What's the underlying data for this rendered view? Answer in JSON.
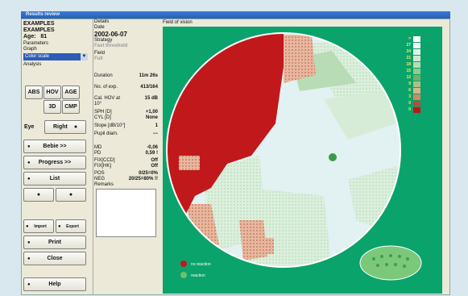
{
  "window": {
    "title": "Results review"
  },
  "patient": {
    "name1": "EXAMPLES",
    "name2": "EXAMPLES",
    "age_label": "Age:",
    "age": "81"
  },
  "parameters": {
    "label": "Parameters",
    "graph_label": "Graph",
    "graph_value": "Color scale"
  },
  "analysis": {
    "label": "Analysis",
    "abs": "ABS",
    "hov": "HOV",
    "age": "AGE",
    "threed": "3D",
    "cmp": "CMP",
    "eye_label": "Eye",
    "eye_value": "Right",
    "bebie": "Bebie >>",
    "progress": "Progress >>",
    "list": "List",
    "import": "Import",
    "export": "Export",
    "print": "Print",
    "close": "Close",
    "help": "Help"
  },
  "details": {
    "label": "Details",
    "date_label": "Date",
    "date": "2002-06-07",
    "strategy_label": "Strategy",
    "strategy": "Fast threshold",
    "field_label": "Field",
    "field": "Full",
    "duration_label": "Duration",
    "duration": "11m 26s",
    "exp_label": "No. of exp.",
    "exp": "413/164",
    "hov_label": "Cal. HOV at 10°",
    "hov": "15 dB",
    "sph_label": "SPH [D]",
    "sph": "+1,00",
    "cyl_label": "CYL [D]",
    "cyl": "None",
    "slope_label": "Slope [dB/10°]",
    "slope": "1",
    "pupil_label": "Pupil diam.",
    "pupil": "---",
    "md_label": "MD",
    "md": "-0,06",
    "pd_label": "PD",
    "pd": "0,59 !",
    "fixccd_label": "FIX[CCD]",
    "fixccd": "Off",
    "fixhk_label": "FIX[HK]",
    "fixhk": "Off",
    "pos_label": "POS",
    "pos": "0/25=0%",
    "neg_label": "NEG",
    "neg": "20/25=80% !!",
    "remarks_label": "Remarks"
  },
  "field_of_vision": {
    "label": "Field of vision",
    "legend_no_reaction": "no reaction",
    "legend_reaction": "reaction",
    "scale": [
      {
        "label": ">",
        "color": "#ffffff"
      },
      {
        "label": "27",
        "color": "#f4f8f4"
      },
      {
        "label": "24",
        "color": "#e4f2e6"
      },
      {
        "label": "21",
        "color": "#cfe8d2"
      },
      {
        "label": "18",
        "color": "#b7dcb6"
      },
      {
        "label": "15",
        "color": "#93c98e"
      },
      {
        "label": "12",
        "color": "#6fb06a"
      },
      {
        "label": "9",
        "color": "#a7c08d"
      },
      {
        "label": "6",
        "color": "#d7b48a"
      },
      {
        "label": "3",
        "color": "#c98a6a"
      },
      {
        "label": "0",
        "color": "#b94a3e"
      },
      {
        "label": "0",
        "color": "#b8181a"
      }
    ]
  }
}
